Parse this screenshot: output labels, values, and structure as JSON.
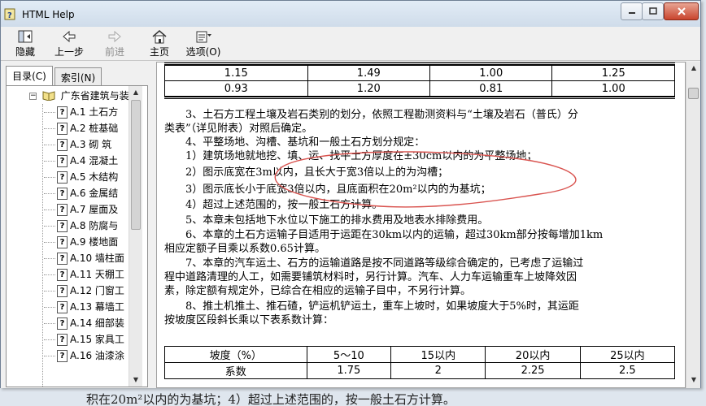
{
  "window": {
    "title": "HTML Help"
  },
  "toolbar": {
    "hide": "隐藏",
    "back": "上一步",
    "forward": "前进",
    "home": "主页",
    "options": "选项(O)"
  },
  "tabs": {
    "contents": "目录(C)",
    "index": "索引(N)"
  },
  "tree": {
    "root": "广东省建筑与装",
    "items": [
      {
        "code": "A.1",
        "label": "土石方"
      },
      {
        "code": "A.2",
        "label": "桩基础"
      },
      {
        "code": "A.3",
        "label": "砌 筑"
      },
      {
        "code": "A.4",
        "label": "混凝土"
      },
      {
        "code": "A.5",
        "label": "木结构"
      },
      {
        "code": "A.6",
        "label": "金属结"
      },
      {
        "code": "A.7",
        "label": "屋面及"
      },
      {
        "code": "A.8",
        "label": "防腐与"
      },
      {
        "code": "A.9",
        "label": "楼地面"
      },
      {
        "code": "A.10",
        "label": "墙柱面"
      },
      {
        "code": "A.11",
        "label": "天棚工"
      },
      {
        "code": "A.12",
        "label": "门窗工"
      },
      {
        "code": "A.13",
        "label": "幕墙工"
      },
      {
        "code": "A.14",
        "label": "细部装"
      },
      {
        "code": "A.15",
        "label": "家具工"
      },
      {
        "code": "A.16",
        "label": "油漆涂"
      }
    ]
  },
  "top_table": {
    "rows": [
      [
        "1.15",
        "1.49",
        "1.00",
        "1.25"
      ],
      [
        "0.93",
        "1.20",
        "0.81",
        "1.00"
      ]
    ]
  },
  "paragraphs": [
    "　　3、土石方工程土壤及岩石类别的划分，依照工程勘测资料与“土壤及岩石（普氏）分",
    "类表”（详见附表）对照后确定。",
    "　　4、平整场地、沟槽、基坑和一般土石方划分规定：",
    "　　1）建筑场地就地挖、填、运、找平土方厚度在±30cm以内的为平整场地；",
    "　　2）图示底宽在3m以内，且长大于宽3倍以上的为沟槽；",
    "　　3）图示底长小于底宽3倍以内，且底面积在20m²以内的为基坑；",
    "　　4）超过上述范围的，按一般土石方计算。",
    "　　5、本章未包括地下水位以下施工的排水费用及地表水排除费用。",
    "　　6、本章的土石方运输子目适用于运距在30km以内的运输，超过30km部分按每增加1km",
    "相应定额子目乘以系数0.65计算。",
    "　　7、本章的汽车运土、石方的运输道路是按不同道路等级综合确定的，已考虑了运输过",
    "程中道路清理的人工，如需要铺筑材料时，另行计算。汽车、人力车运输重车上坡降效因",
    "素，除定额有规定外，已综合在相应的运输子目中，不另行计算。",
    "　　8、推土机推土、推石碴，铲运机铲运土，重车上坡时，如果坡度大于5%时，其运距",
    "按坡度区段斜长乘以下表系数计算："
  ],
  "bottom_table": {
    "header": [
      "坡度（%）",
      "5～10",
      "15以内",
      "20以内",
      "25以内"
    ],
    "row": [
      "系数",
      "1.75",
      "2",
      "2.25",
      "2.5"
    ]
  },
  "background_text": "积在20m²以内的为基坑；4）超过上述范围的，按一般土石方计算。",
  "colors": {
    "annotation": "#d9534f",
    "title_bar": "#d6e2ee",
    "close_button": "#c9442d"
  }
}
